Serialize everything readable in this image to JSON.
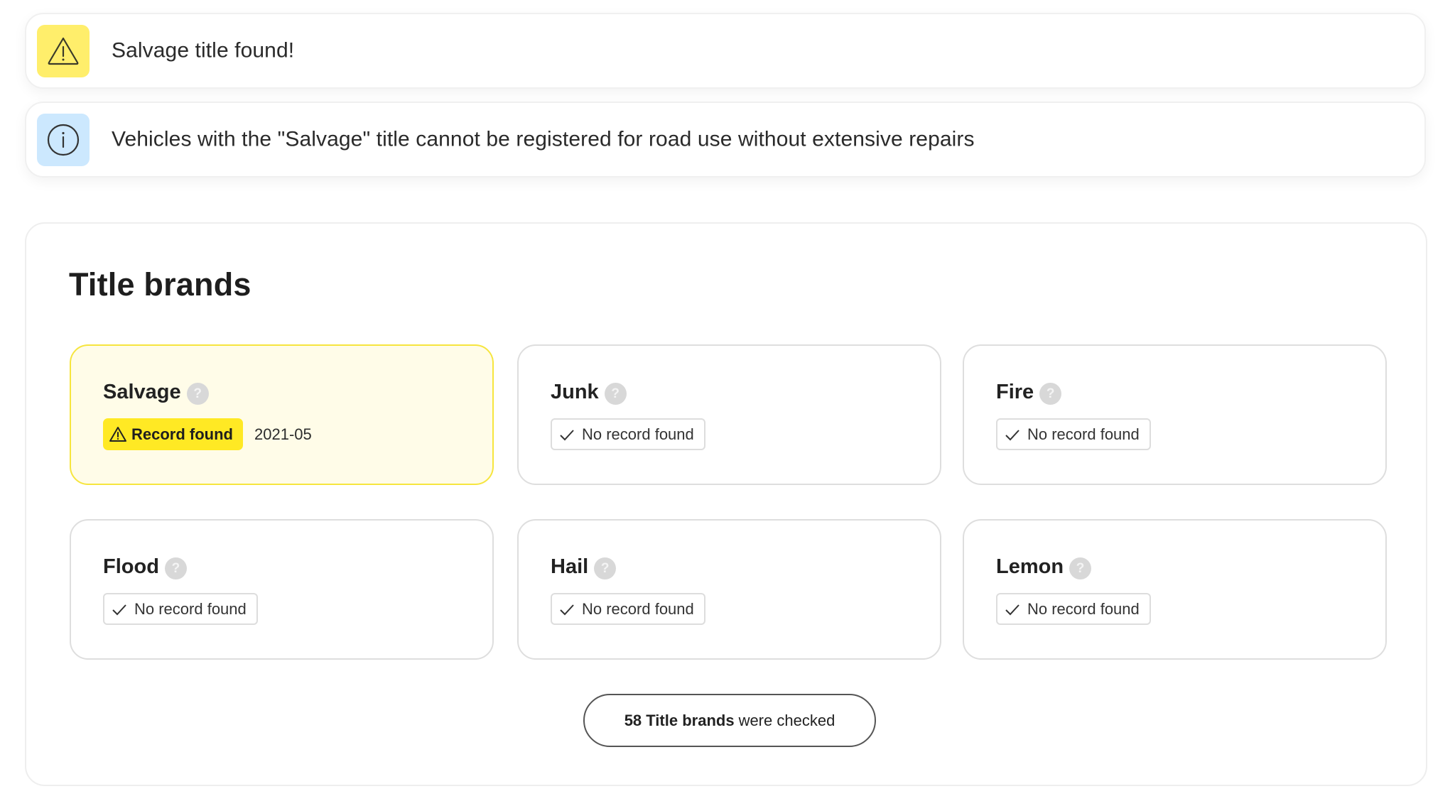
{
  "alerts": [
    {
      "type": "warning",
      "icon": "warning-triangle-icon",
      "text": "Salvage title found!",
      "color": "#FFEE6B"
    },
    {
      "type": "info",
      "icon": "info-circle-icon",
      "text": "Vehicles with the \"Salvage\" title cannot be registered for road use without extensive repairs",
      "color": "#CCE8FE"
    }
  ],
  "title_brands": {
    "heading": "Title brands",
    "help_glyph": "?",
    "items": [
      {
        "name": "Salvage",
        "found": true,
        "status_label": "Record found",
        "date": "2021-05"
      },
      {
        "name": "Junk",
        "found": false,
        "status_label": "No record found"
      },
      {
        "name": "Fire",
        "found": false,
        "status_label": "No record found"
      },
      {
        "name": "Flood",
        "found": false,
        "status_label": "No record found"
      },
      {
        "name": "Hail",
        "found": false,
        "status_label": "No record found"
      },
      {
        "name": "Lemon",
        "found": false,
        "status_label": "No record found"
      }
    ],
    "summary": {
      "count_bold": "58 Title brands",
      "rest": "were checked"
    },
    "colors": {
      "found_badge": "#FFE924",
      "found_card_bg": "#FFFCE8",
      "found_card_border": "#F6E53E"
    }
  }
}
